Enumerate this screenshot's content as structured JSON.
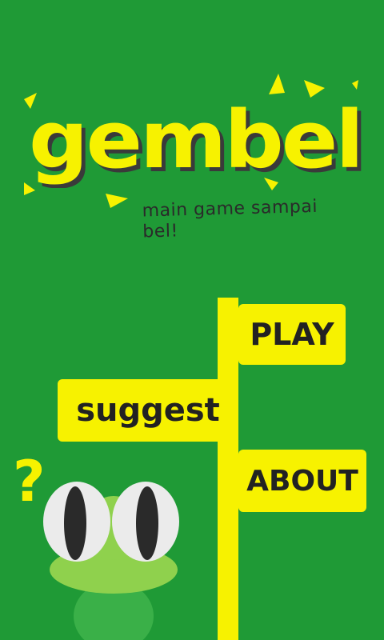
{
  "app": {
    "title": "gembel",
    "tagline": "main game sampai bel!"
  },
  "menu": {
    "play_label": "PLAY",
    "suggest_label": "suggest",
    "about_label": "ABOUT"
  },
  "mascot": {
    "question_mark": "?"
  },
  "colors": {
    "background": "#1f9a36",
    "accent": "#f7f200",
    "text_dark": "#222222",
    "frog_light": "#8fd14d",
    "frog_body": "#3ab048"
  },
  "icons": [
    "triangle-sparkle-icon",
    "question-mark-icon",
    "frog-mascot"
  ]
}
